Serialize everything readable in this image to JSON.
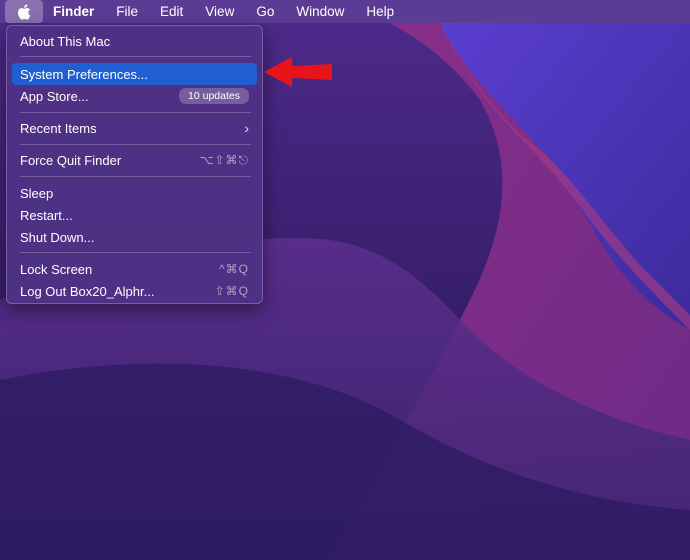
{
  "menubar": {
    "apple_icon": "apple-logo",
    "items": [
      "Finder",
      "File",
      "Edit",
      "View",
      "Go",
      "Window",
      "Help"
    ]
  },
  "apple_menu": {
    "about": "About This Mac",
    "system_preferences": "System Preferences...",
    "app_store": "App Store...",
    "app_store_badge": "10 updates",
    "recent_items": "Recent Items",
    "recent_items_chevron": "›",
    "force_quit": "Force Quit Finder",
    "force_quit_shortcut": "⌥⇧⌘⎋",
    "sleep": "Sleep",
    "restart": "Restart...",
    "shut_down": "Shut Down...",
    "lock_screen": "Lock Screen",
    "lock_screen_shortcut": "^⌘Q",
    "log_out": "Log Out Box20_Alphr...",
    "log_out_shortcut": "⇧⌘Q",
    "highlighted_item": "System Preferences..."
  },
  "annotation": {
    "arrow_icon": "red-arrow-pointing-left",
    "arrow_color": "#e8141c"
  },
  "colors": {
    "highlight": "#1f5fd1",
    "desktop_base": "#2a1a5e"
  }
}
